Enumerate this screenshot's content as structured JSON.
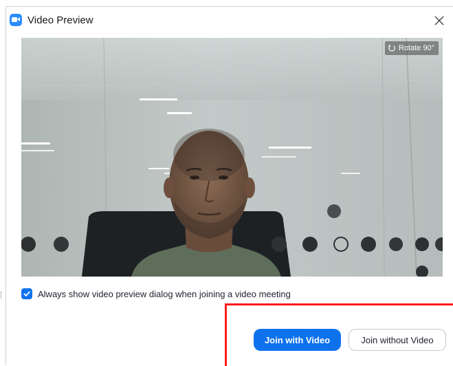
{
  "window": {
    "title": "Video Preview",
    "close_symbol": "✕"
  },
  "preview": {
    "rotate_label": "Rotate 90°",
    "icons": {
      "rotate": "rotate-icon"
    }
  },
  "options": {
    "always_show_preview": {
      "checked": true,
      "label": "Always show video preview dialog when joining a video meeting"
    }
  },
  "actions": {
    "join_with_video": "Join with Video",
    "join_without_video": "Join without Video"
  },
  "colors": {
    "accent": "#0e72ed",
    "highlight": "#ff1a1a"
  }
}
